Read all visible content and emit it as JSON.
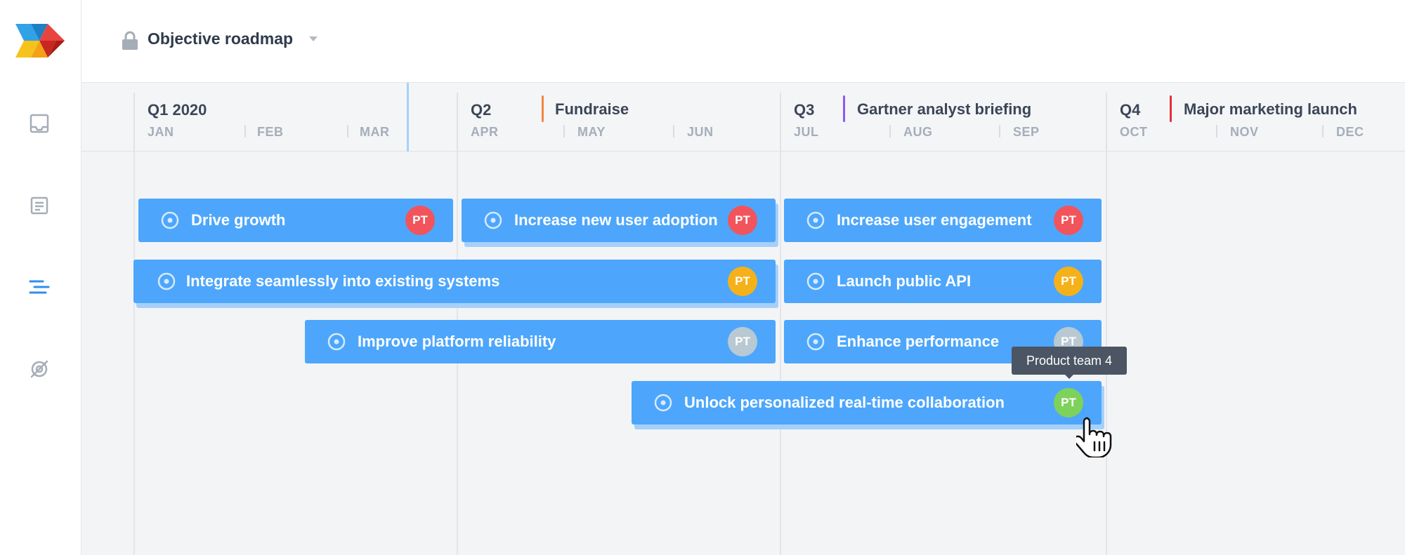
{
  "header": {
    "title": "Objective roadmap",
    "icons": {
      "lock": "lock-icon",
      "caret": "caret-down-icon"
    }
  },
  "sidebar": {
    "items": [
      {
        "name": "inbox",
        "icon": "inbox-icon",
        "active": false
      },
      {
        "name": "notes",
        "icon": "document-icon",
        "active": false
      },
      {
        "name": "roadmap",
        "icon": "roadmap-icon",
        "active": true
      },
      {
        "name": "hidden",
        "icon": "eye-off-icon",
        "active": false
      }
    ]
  },
  "timeline": {
    "quarters": [
      {
        "label": "Q1 2020",
        "months": [
          "JAN",
          "FEB",
          "MAR"
        ]
      },
      {
        "label": "Q2",
        "months": [
          "APR",
          "MAY",
          "JUN"
        ]
      },
      {
        "label": "Q3",
        "months": [
          "JUL",
          "AUG",
          "SEP"
        ]
      },
      {
        "label": "Q4",
        "months": [
          "OCT",
          "NOV",
          "DEC"
        ]
      }
    ],
    "milestones": [
      {
        "label": "Fundraise",
        "color": "#f5863d"
      },
      {
        "label": "Gartner analyst briefing",
        "color": "#8b5cf6"
      },
      {
        "label": "Major marketing launch",
        "color": "#e5303f"
      }
    ]
  },
  "objectives": [
    {
      "label": "Drive growth",
      "avatar": "PT",
      "avatar_color": "#f2545b"
    },
    {
      "label": "Increase new user adoption",
      "avatar": "PT",
      "avatar_color": "#f2545b"
    },
    {
      "label": "Increase user engagement",
      "avatar": "PT",
      "avatar_color": "#f2545b"
    },
    {
      "label": "Integrate seamlessly into existing systems",
      "avatar": "PT",
      "avatar_color": "#f5b119"
    },
    {
      "label": "Launch public API",
      "avatar": "PT",
      "avatar_color": "#f5b119"
    },
    {
      "label": "Improve platform reliability",
      "avatar": "PT",
      "avatar_color": "#b8c9d3"
    },
    {
      "label": "Enhance performance",
      "avatar": "PT",
      "avatar_color": "#b8c9d3"
    },
    {
      "label": "Unlock personalized real-time collaboration",
      "avatar": "PT",
      "avatar_color": "#7dd25b"
    }
  ],
  "tooltip": {
    "text": "Product team 4"
  },
  "colors": {
    "bar": "#4da6fb",
    "bar_shadow": "#a6d0fa",
    "accent": "#2f8ef0",
    "today_line": "#a7d0fb"
  }
}
